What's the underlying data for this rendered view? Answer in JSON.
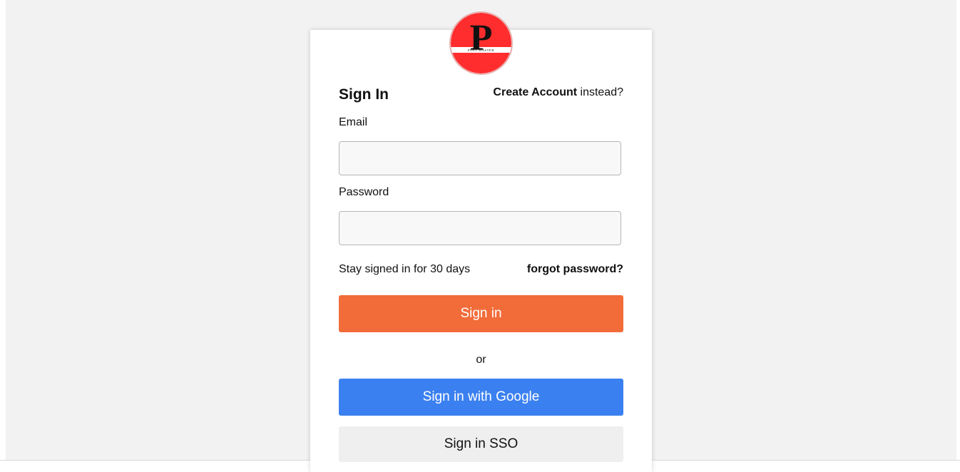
{
  "logo": {
    "letter": "P",
    "tagline": "POST MASTER",
    "colors": {
      "circle": "#ff2d2d",
      "letter": "#111111"
    }
  },
  "form": {
    "title": "Sign In",
    "create_account_link": "Create Account",
    "create_account_suffix": " instead?",
    "email_label": "Email",
    "email_value": "",
    "password_label": "Password",
    "password_value": "",
    "stay_signed_in_text": "Stay signed in for 30 days",
    "forgot_password_link": "forgot password?",
    "signin_button": "Sign in",
    "or_text": "or",
    "google_button": "Sign in with Google",
    "sso_button": "Sign in SSO"
  },
  "colors": {
    "page_background": "#f2f2f2",
    "signin_button": "#f26c3a",
    "google_button": "#3b80f0",
    "sso_button": "#efefef"
  }
}
